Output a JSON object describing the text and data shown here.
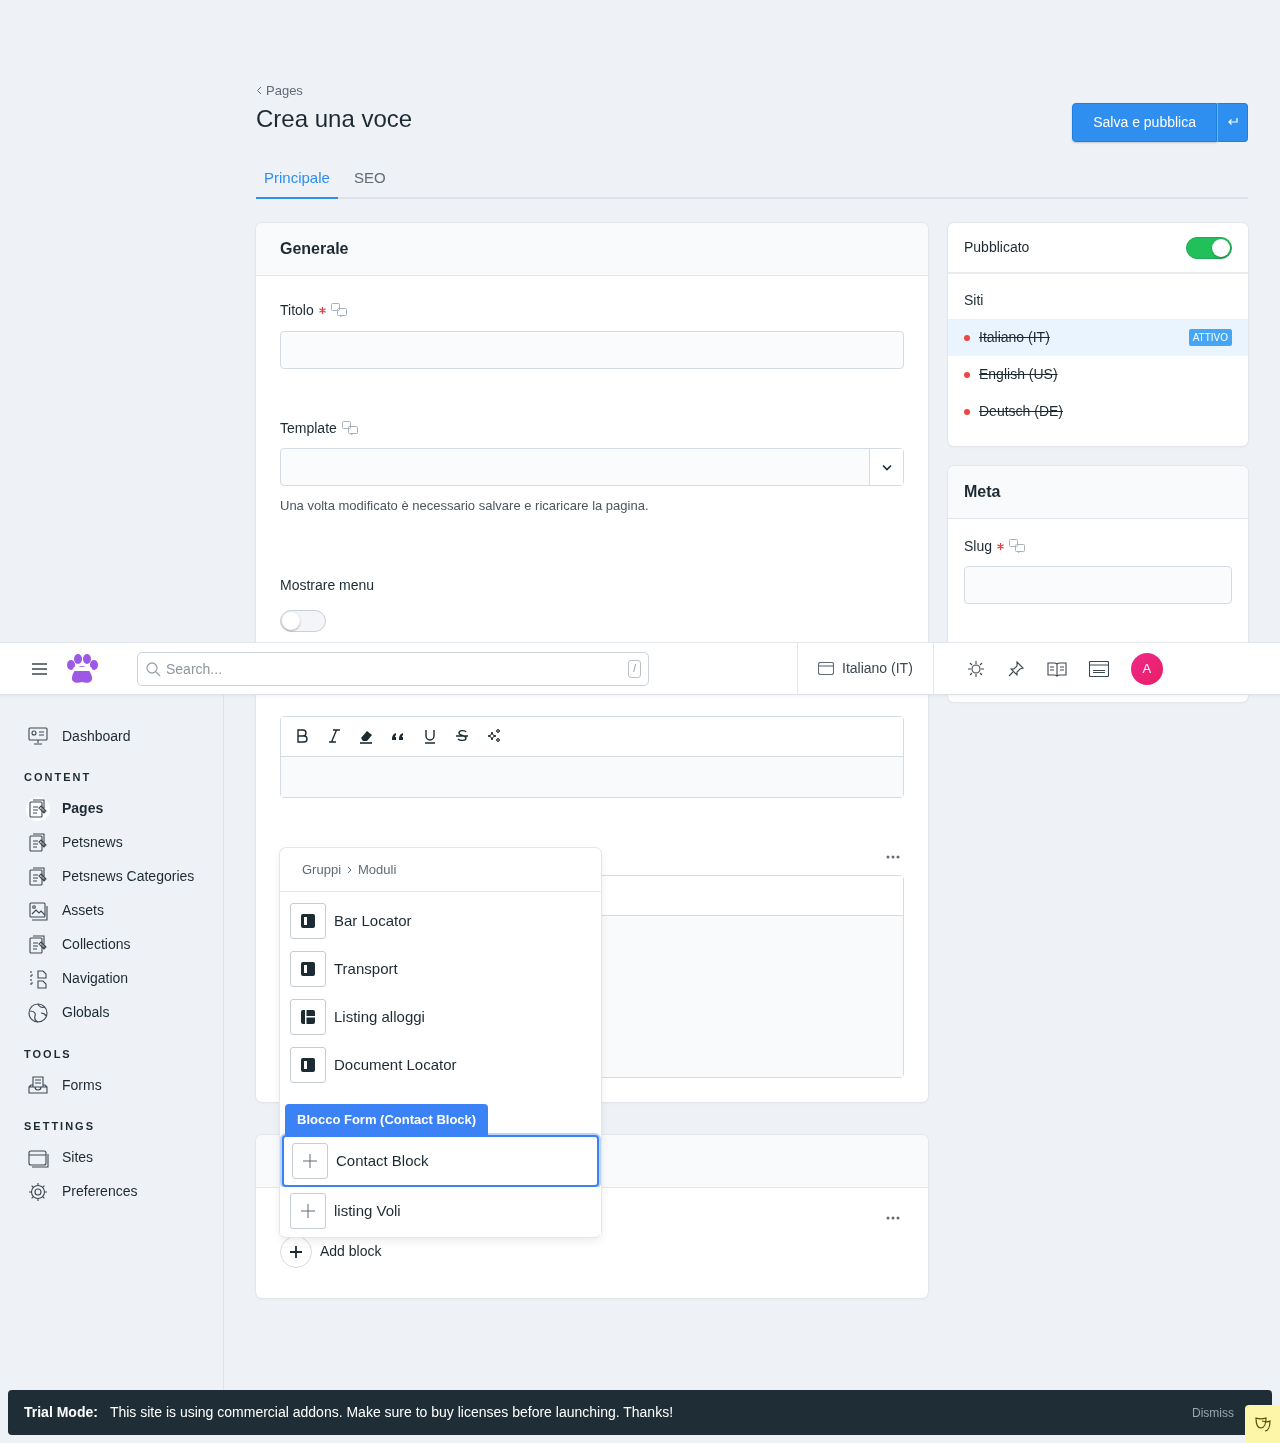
{
  "breadcrumb": {
    "label": "Pages"
  },
  "title": "Crea una voce",
  "save_button": {
    "label": "Salva e pubblica"
  },
  "tabs": [
    {
      "label": "Principale",
      "selected": true
    },
    {
      "label": "SEO",
      "selected": false
    }
  ],
  "generale": {
    "title": "Generale",
    "fields": [
      {
        "kind": "text",
        "label": "Titolo",
        "required": true,
        "translatable": true
      },
      {
        "kind": "select",
        "label": "Template",
        "required": false,
        "translatable": true,
        "help": "Una volta modificato è necessario salvare e ricaricare la pagina."
      },
      {
        "kind": "toggle",
        "label": "Mostrare menu",
        "required": false,
        "translatable": false,
        "on": false
      }
    ]
  },
  "add_block": {
    "label": "Add block"
  },
  "publish": {
    "label": "Pubblicato",
    "on": true
  },
  "sites": {
    "title": "Siti",
    "items": [
      {
        "name": "Italiano (IT)",
        "published": false,
        "selected": true,
        "badge": "ATTIVO"
      },
      {
        "name": "English (US)",
        "published": false,
        "selected": false
      },
      {
        "name": "Deutsch (DE)",
        "published": false,
        "selected": false
      }
    ]
  },
  "meta": {
    "title": "Meta",
    "fields": [
      {
        "label": "Slug",
        "required": true,
        "translatable": true
      }
    ]
  },
  "topbar": {
    "search": {
      "placeholder": "Search...",
      "shortcut": "/"
    },
    "site": "Italiano (IT)",
    "avatar": "A"
  },
  "sidebar": {
    "sections": [
      {
        "items": [
          {
            "label": "Dashboard",
            "selected": false
          }
        ]
      },
      {
        "heading": "CONTENT",
        "items": [
          {
            "label": "Pages",
            "selected": true
          },
          {
            "label": "Petsnews",
            "selected": false
          },
          {
            "label": "Petsnews Categories",
            "selected": false
          },
          {
            "label": "Assets",
            "selected": false
          },
          {
            "label": "Collections",
            "selected": false
          },
          {
            "label": "Navigation",
            "selected": false
          },
          {
            "label": "Globals",
            "selected": false
          }
        ]
      },
      {
        "heading": "TOOLS",
        "items": [
          {
            "label": "Forms",
            "selected": false
          }
        ]
      },
      {
        "heading": "SETTINGS",
        "items": [
          {
            "label": "Sites",
            "selected": false
          },
          {
            "label": "Preferences",
            "selected": false
          }
        ]
      }
    ]
  },
  "block_picker": {
    "path": [
      "Gruppi",
      "Moduli"
    ],
    "tooltip": "Blocco Form (Contact Block)",
    "items": [
      {
        "kind": "column",
        "label": "Bar Locator",
        "selected": false
      },
      {
        "kind": "column",
        "label": "Transport",
        "selected": false
      },
      {
        "kind": "grid",
        "label": "Listing alloggi",
        "selected": false
      },
      {
        "kind": "column",
        "label": "Document Locator",
        "selected": false
      },
      {
        "kind": "hidden"
      },
      {
        "kind": "plain",
        "label": "Contact Block",
        "selected": true
      },
      {
        "kind": "plain",
        "label": "listing Voli",
        "selected": false
      }
    ]
  },
  "trial_bar": {
    "title": "Trial Mode:",
    "message": "This site is using commercial addons. Make sure to buy licenses before launching. Thanks!",
    "dismiss": "Dismiss"
  }
}
